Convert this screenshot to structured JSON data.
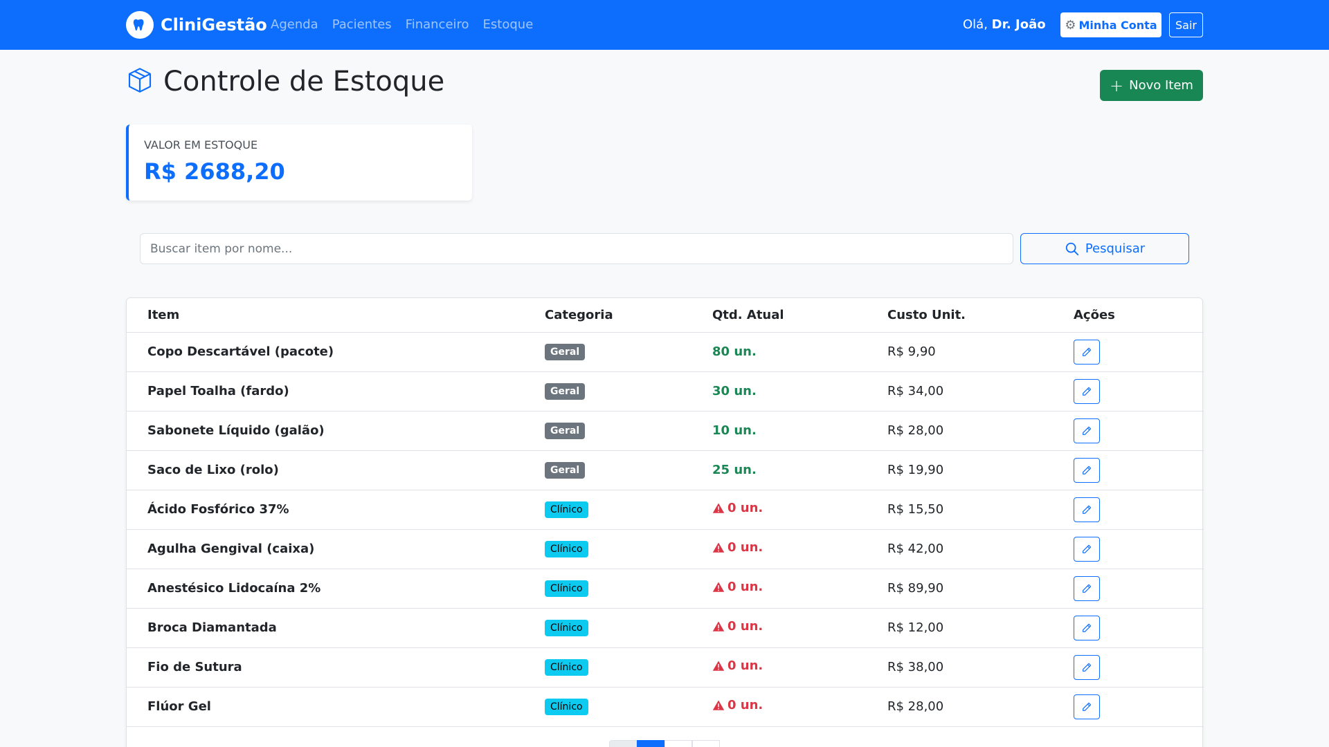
{
  "navbar": {
    "brand": "CliniGestão",
    "links": [
      "Agenda",
      "Pacientes",
      "Financeiro",
      "Estoque"
    ],
    "greeting_prefix": "Olá,",
    "greeting_name": "Dr. João",
    "account_label": "Minha Conta",
    "logout_label": "Sair",
    "colors": {
      "primary": "#0d6efd"
    }
  },
  "page": {
    "title": "Controle de Estoque",
    "new_item_label": "Novo Item"
  },
  "stat": {
    "label": "VALOR EM ESTOQUE",
    "value": "R$ 2688,20"
  },
  "search": {
    "placeholder": "Buscar item por nome...",
    "button_label": "Pesquisar"
  },
  "table": {
    "headers": [
      "Item",
      "Categoria",
      "Qtd. Atual",
      "Custo Unit.",
      "Ações"
    ],
    "rows": [
      {
        "item": "Copo Descartável (pacote)",
        "category": "Geral",
        "qty": "80 un.",
        "low": false,
        "cost": "R$ 9,90"
      },
      {
        "item": "Papel Toalha (fardo)",
        "category": "Geral",
        "qty": "30 un.",
        "low": false,
        "cost": "R$ 34,00"
      },
      {
        "item": "Sabonete Líquido (galão)",
        "category": "Geral",
        "qty": "10 un.",
        "low": false,
        "cost": "R$ 28,00"
      },
      {
        "item": "Saco de Lixo (rolo)",
        "category": "Geral",
        "qty": "25 un.",
        "low": false,
        "cost": "R$ 19,90"
      },
      {
        "item": "Ácido Fosfórico 37%",
        "category": "Clínico",
        "qty": "0 un.",
        "low": true,
        "cost": "R$ 15,50"
      },
      {
        "item": "Agulha Gengival (caixa)",
        "category": "Clínico",
        "qty": "0 un.",
        "low": true,
        "cost": "R$ 42,00"
      },
      {
        "item": "Anestésico Lidocaína 2%",
        "category": "Clínico",
        "qty": "0 un.",
        "low": true,
        "cost": "R$ 89,90"
      },
      {
        "item": "Broca Diamantada",
        "category": "Clínico",
        "qty": "0 un.",
        "low": true,
        "cost": "R$ 12,00"
      },
      {
        "item": "Fio de Sutura",
        "category": "Clínico",
        "qty": "0 un.",
        "low": true,
        "cost": "R$ 38,00"
      },
      {
        "item": "Flúor Gel",
        "category": "Clínico",
        "qty": "0 un.",
        "low": true,
        "cost": "R$ 28,00"
      }
    ]
  },
  "icons": {
    "brand": "tooth-icon",
    "account": "gear-icon",
    "title": "box-icon",
    "new": "plus-icon",
    "search": "search-icon",
    "low_stock": "warning-icon",
    "edit": "pencil-icon"
  }
}
